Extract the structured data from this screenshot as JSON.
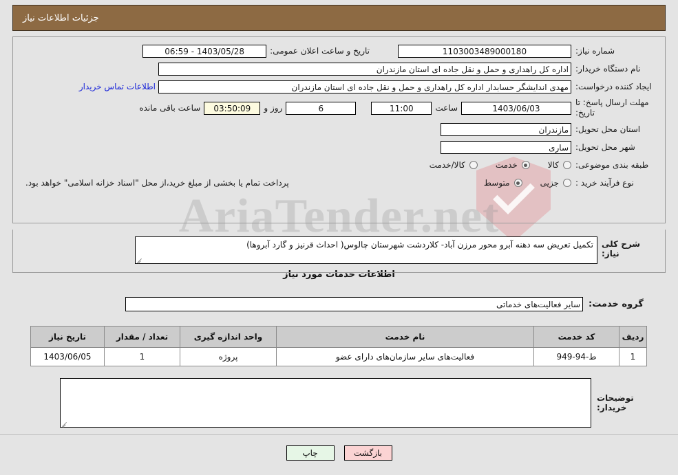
{
  "header": {
    "title": "جزئیات اطلاعات نیاز"
  },
  "form": {
    "need_number_label": "شماره نیاز:",
    "need_number_value": "1103003489000180",
    "announce_label": "تاریخ و ساعت اعلان عمومی:",
    "announce_value": "1403/05/28 - 06:59",
    "buyer_org_label": "نام دستگاه خریدار:",
    "buyer_org_value": "اداره کل راهداری و حمل و نقل جاده ای استان مازندران",
    "creator_label": "ایجاد کننده درخواست:",
    "creator_value": "مهدی اندایشگر حسابدار اداره کل راهداری و حمل و نقل جاده ای استان مازندران",
    "contact_link": "اطلاعات تماس خریدار",
    "deadline_label": "مهلت ارسال پاسخ: تا تاریخ:",
    "deadline_date": "1403/06/03",
    "deadline_hour_label": "ساعت",
    "deadline_hour": "11:00",
    "days_value": "6",
    "days_label": "روز و",
    "countdown": "03:50:09",
    "remaining_label": "ساعت باقی مانده",
    "province_label": "استان محل تحویل:",
    "province_value": "مازندران",
    "city_label": "شهر محل تحویل:",
    "city_value": "ساری",
    "category_label": "طبقه بندی موضوعی:",
    "category_options": [
      {
        "label": "کالا",
        "selected": false
      },
      {
        "label": "خدمت",
        "selected": true
      },
      {
        "label": "کالا/خدمت",
        "selected": false
      }
    ],
    "process_label": "نوع فرآیند خرید :",
    "process_options": [
      {
        "label": "جزیی",
        "selected": false
      },
      {
        "label": "متوسط",
        "selected": true
      }
    ],
    "process_note": "پرداخت تمام یا بخشی از مبلغ خرید،از محل \"اسناد خزانه اسلامی\" خواهد بود."
  },
  "description": {
    "label": "شرح کلی نیاز:",
    "value": "تکمیل تعریض سه دهنه آبرو محور مرزن آباد- کلاردشت شهرستان چالوس( احداث قرنیز و گارد آبروها)"
  },
  "services": {
    "heading": "اطلاعات خدمات مورد نیاز",
    "group_label": "گروه خدمت:",
    "group_value": "سایر فعالیت‌های خدماتی",
    "columns": [
      "ردیف",
      "کد خدمت",
      "نام خدمت",
      "واحد اندازه گیری",
      "تعداد / مقدار",
      "تاریخ نیاز"
    ],
    "rows": [
      {
        "index": "1",
        "code": "ط-94-949",
        "name": "فعالیت‌های سایر سازمان‌های دارای عضو",
        "unit": "پروژه",
        "quantity": "1",
        "need_date": "1403/06/05"
      }
    ]
  },
  "buyer_notes": {
    "label": "توضیحات خریدار:",
    "value": ""
  },
  "footer": {
    "print_label": "چاپ",
    "back_label": "بازگشت"
  },
  "watermark": {
    "text": "AriaTender.net"
  }
}
